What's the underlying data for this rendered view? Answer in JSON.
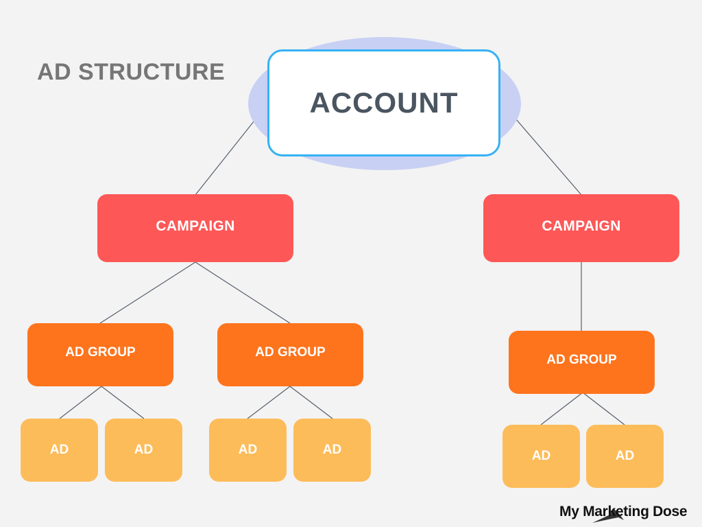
{
  "title": "AD STRUCTURE",
  "root": {
    "label": "ACCOUNT",
    "campaigns": [
      {
        "label": "CAMPAIGN",
        "ad_groups": [
          {
            "label": "AD GROUP",
            "ads": [
              "AD",
              "AD"
            ]
          },
          {
            "label": "AD GROUP",
            "ads": [
              "AD",
              "AD"
            ]
          }
        ]
      },
      {
        "label": "CAMPAIGN",
        "ad_groups": [
          {
            "label": "AD GROUP",
            "ads": [
              "AD",
              "AD"
            ]
          }
        ]
      }
    ]
  },
  "colors": {
    "background": "#f3f3f3",
    "account_border": "#35b1f5",
    "account_halo": "#c8d0f4",
    "campaign": "#fe5757",
    "ad_group": "#fe741d",
    "ad": "#fdbc5a",
    "connector": "#555e6a"
  },
  "brand": "My Marketing Dose"
}
